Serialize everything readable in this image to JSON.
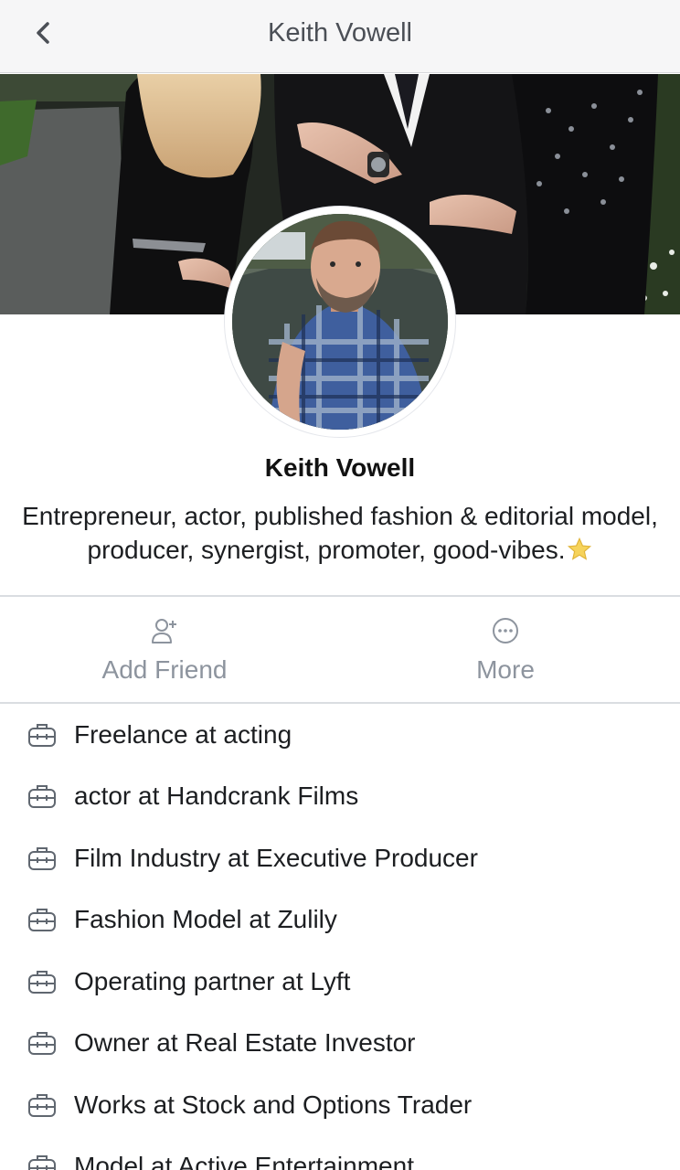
{
  "header": {
    "title": "Keith Vowell",
    "back_icon": "chevron-left-icon"
  },
  "profile": {
    "name": "Keith Vowell",
    "bio": "Entrepreneur, actor, published fashion & editorial model, producer, synergist, promoter, good-vibes.",
    "bio_emoji": "star-icon"
  },
  "actions": {
    "add_friend": {
      "label": "Add Friend",
      "icon": "add-person-icon"
    },
    "more": {
      "label": "More",
      "icon": "more-dots-icon"
    }
  },
  "work": {
    "icon": "briefcase-icon",
    "items": [
      "Freelance at acting",
      "actor at Handcrank Films",
      "Film Industry at Executive Producer",
      "Fashion Model at Zulily",
      "Operating partner at Lyft",
      "Owner at Real Estate Investor",
      "Works at Stock and Options Trader",
      "Model at Active Entertainment"
    ]
  },
  "colors": {
    "header_bg": "#f6f6f7",
    "muted_text": "#8d949e",
    "divider": "#dadde1"
  }
}
